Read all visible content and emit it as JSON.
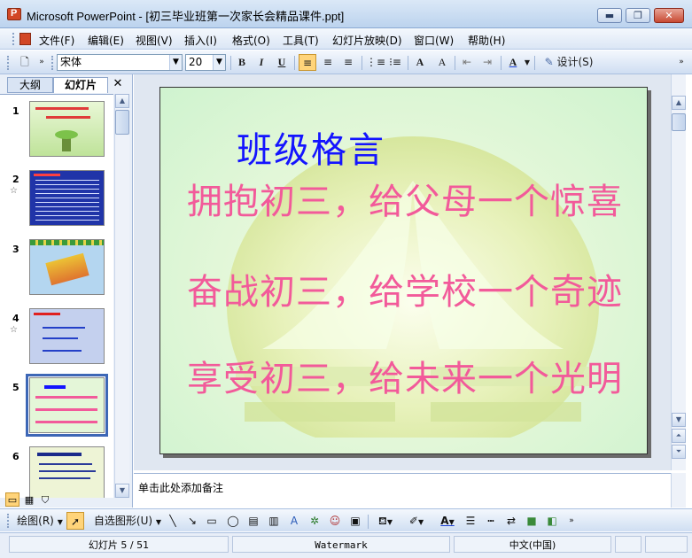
{
  "window": {
    "title": "Microsoft PowerPoint - [初三毕业班第一次家长会精品课件.ppt]",
    "minimize": "▬",
    "restore": "❐",
    "close": "✕"
  },
  "menu": {
    "items": [
      {
        "label": "文件(F)"
      },
      {
        "label": "编辑(E)"
      },
      {
        "label": "视图(V)"
      },
      {
        "label": "插入(I)"
      },
      {
        "label": "格式(O)"
      },
      {
        "label": "工具(T)"
      },
      {
        "label": "幻灯片放映(D)"
      },
      {
        "label": "窗口(W)"
      },
      {
        "label": "帮助(H)"
      }
    ]
  },
  "toolbar": {
    "font_name": "宋体",
    "font_size": "20",
    "bold": "B",
    "italic": "I",
    "underline": "U",
    "grow_font": "A",
    "shrink_font": "A",
    "font_color": "A",
    "design": "设计(S)"
  },
  "outline_pane": {
    "tabs": [
      {
        "label": "大纲"
      },
      {
        "label": "幻灯片"
      }
    ],
    "active_tab": "幻灯片",
    "close": "✕",
    "thumbnails": [
      {
        "number": "1",
        "star": ""
      },
      {
        "number": "2",
        "star": "☆"
      },
      {
        "number": "3",
        "star": ""
      },
      {
        "number": "4",
        "star": "☆"
      },
      {
        "number": "5",
        "star": ""
      },
      {
        "number": "6",
        "star": ""
      }
    ],
    "selected_slide": 5
  },
  "slide": {
    "title": "班级格言",
    "lines": [
      "拥抱初三，给父母一个惊喜",
      "奋战初三，给学校一个奇迹",
      "享受初三，给未来一个光明"
    ],
    "title_color": "#1414ff",
    "body_color": "#f25a9a"
  },
  "notes": {
    "placeholder": "单击此处添加备注"
  },
  "draw_toolbar": {
    "draw_label": "绘图(R)",
    "autoshapes_label": "自选图形(U)"
  },
  "status": {
    "slide_position": "幻灯片 5 / 51",
    "template": "Watermark",
    "language": "中文(中国)"
  },
  "colors": {
    "accent": "#3d67b6",
    "highlight": "#ffd47a"
  }
}
